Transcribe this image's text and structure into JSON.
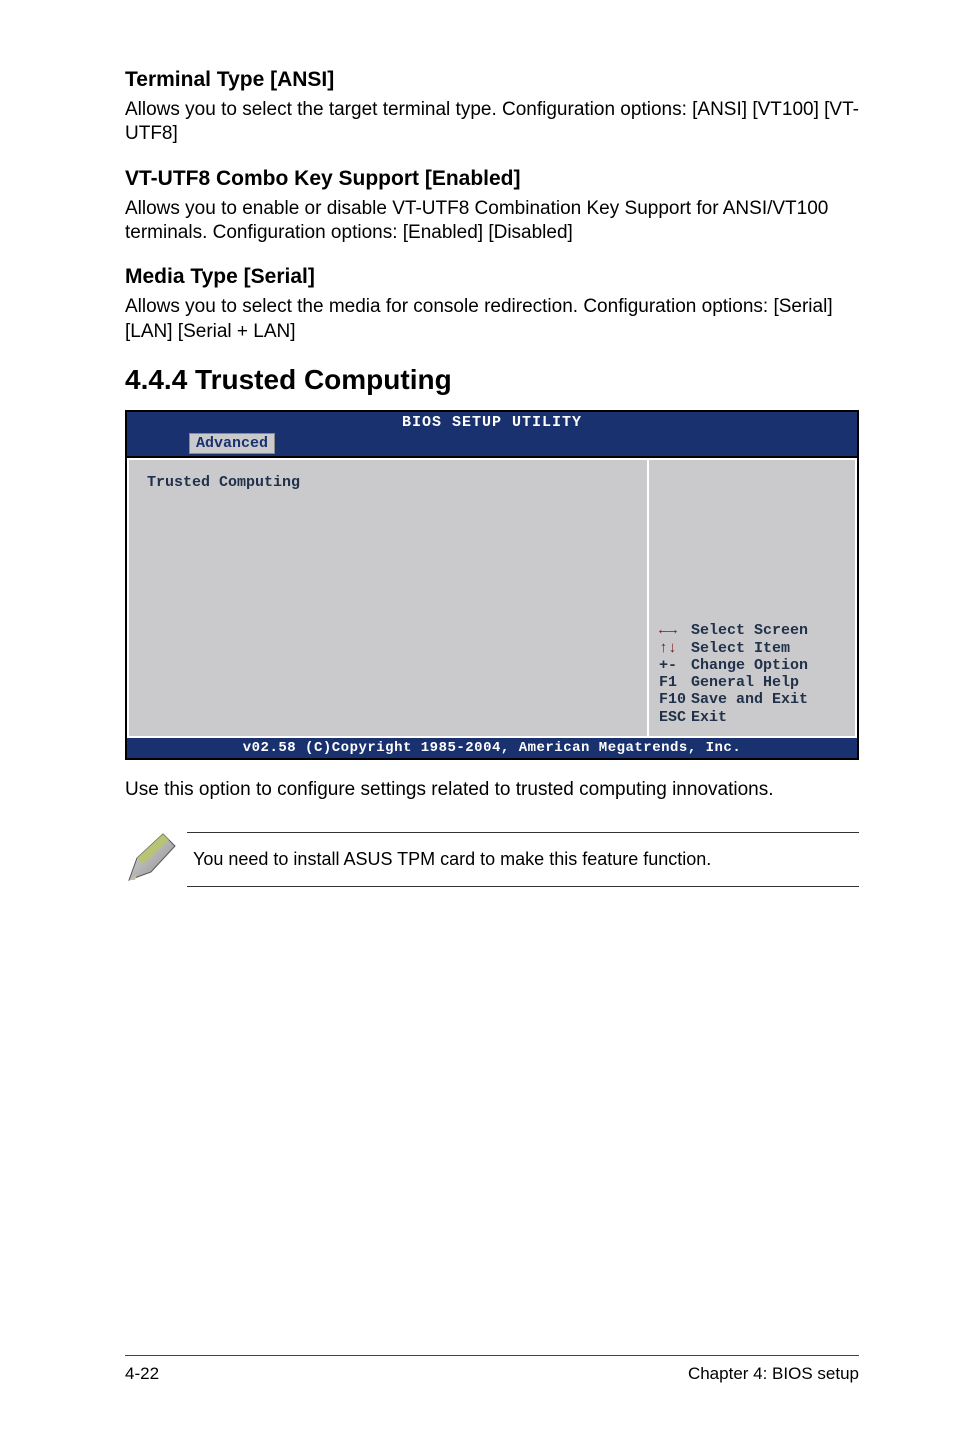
{
  "sections": {
    "terminal": {
      "heading": "Terminal Type [ANSI]",
      "body": "Allows you to select the target terminal type. Configuration options: [ANSI] [VT100] [VT-UTF8]"
    },
    "combo": {
      "heading": "VT-UTF8 Combo Key Support [Enabled]",
      "body": "Allows you to enable or disable VT-UTF8 Combination Key Support for ANSI/VT100 terminals. Configuration options: [Enabled] [Disabled]"
    },
    "media": {
      "heading": "Media Type [Serial]",
      "body": "Allows you to select the media for console redirection. Configuration options: [Serial] [LAN] [Serial + LAN]"
    }
  },
  "main_heading": "4.4.4 Trusted Computing",
  "bios": {
    "title": "BIOS SETUP UTILITY",
    "tab": "Advanced",
    "left_label": "Trusted Computing",
    "legend": {
      "select_screen": "Select Screen",
      "select_item": "Select Item",
      "change_option_key": "+-",
      "change_option": "Change Option",
      "general_help_key": "F1",
      "general_help": "General Help",
      "save_exit_key": "F10",
      "save_exit": "Save and Exit",
      "esc_key": "ESC",
      "esc": "Exit"
    },
    "footer": "v02.58 (C)Copyright 1985-2004, American Megatrends, Inc."
  },
  "after_bios": "Use this option to configure settings related to trusted computing innovations.",
  "note": "You need to install ASUS TPM card to make this feature function.",
  "footer": {
    "left": "4-22",
    "right": "Chapter 4: BIOS setup"
  }
}
